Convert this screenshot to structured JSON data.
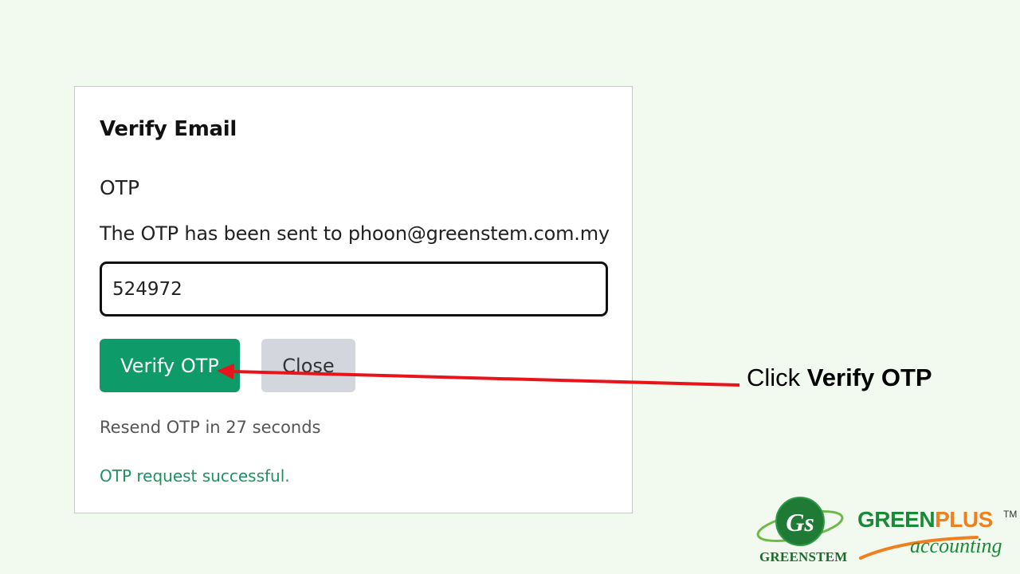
{
  "dialog": {
    "title": "Verify Email",
    "otp_label": "OTP",
    "sent_message": "The OTP has been sent to phoon@greenstem.com.my",
    "otp_value": "524972",
    "verify_button_label": "Verify OTP",
    "close_button_label": "Close",
    "resend_text": "Resend OTP in 27 seconds",
    "status_message": "OTP request successful."
  },
  "annotation": {
    "prefix": "Click",
    "target": "Verify OTP",
    "arrow_color": "#e8141c"
  },
  "branding": {
    "greenstem_monogram": "Gs",
    "greenstem_name": "GREENSTEM",
    "greenplus_green": "GREEN",
    "greenplus_orange": "PLUS",
    "trademark": "TM",
    "accounting": "accounting"
  },
  "colors": {
    "verify_button": "#0f9a6a",
    "close_button": "#d3d6dd",
    "success_text": "#1e9160",
    "page_background": "#f2f9ee",
    "brand_green": "#1a8a3a",
    "brand_orange": "#f07f1d"
  }
}
